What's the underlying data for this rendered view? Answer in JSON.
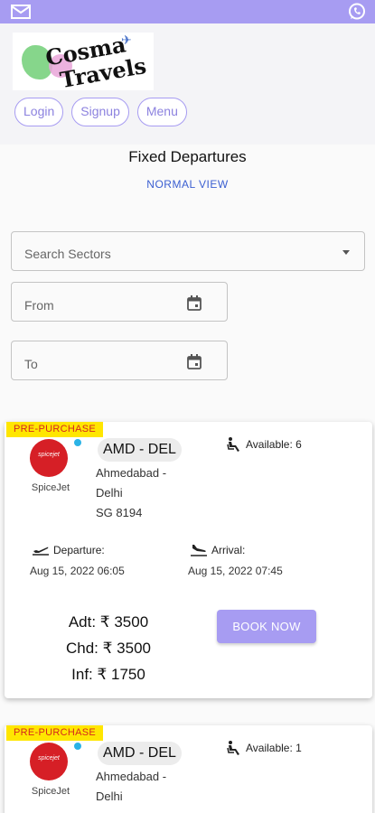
{
  "topbar": {
    "color": "#a79cf2",
    "left_icon": "mail-icon",
    "right_icon": "whatsapp-icon"
  },
  "brand": {
    "line1": "Cosma",
    "line2": "Travels"
  },
  "nav": {
    "login": "Login",
    "signup": "Signup",
    "menu": "Menu"
  },
  "page": {
    "title": "Fixed Departures",
    "view_toggle": "NORMAL VIEW"
  },
  "filters": {
    "sectors_placeholder": "Search Sectors",
    "from_placeholder": "From",
    "to_placeholder": "To"
  },
  "flights": [
    {
      "badge": "PRE-PURCHASE",
      "airline_logo_text": "spicejet",
      "airline": "SpiceJet",
      "route": "AMD - DEL",
      "city_line1": "Ahmedabad -",
      "city_line2": "Delhi",
      "flight_no": "SG 8194",
      "available": "Available: 6",
      "departure_label": "Departure:",
      "departure_time": "Aug 15, 2022 06:05",
      "arrival_label": "Arrival:",
      "arrival_time": "Aug 15, 2022 07:45",
      "adult_price": "Adt: ₹ 3500",
      "child_price": "Chd: ₹ 3500",
      "infant_price": "Inf: ₹ 1750",
      "book_label": "BOOK NOW"
    },
    {
      "badge": "PRE-PURCHASE",
      "airline_logo_text": "spicejet",
      "airline": "SpiceJet",
      "route": "AMD - DEL",
      "city_line1": "Ahmedabad -",
      "city_line2": "Delhi",
      "available": "Available: 1"
    }
  ]
}
